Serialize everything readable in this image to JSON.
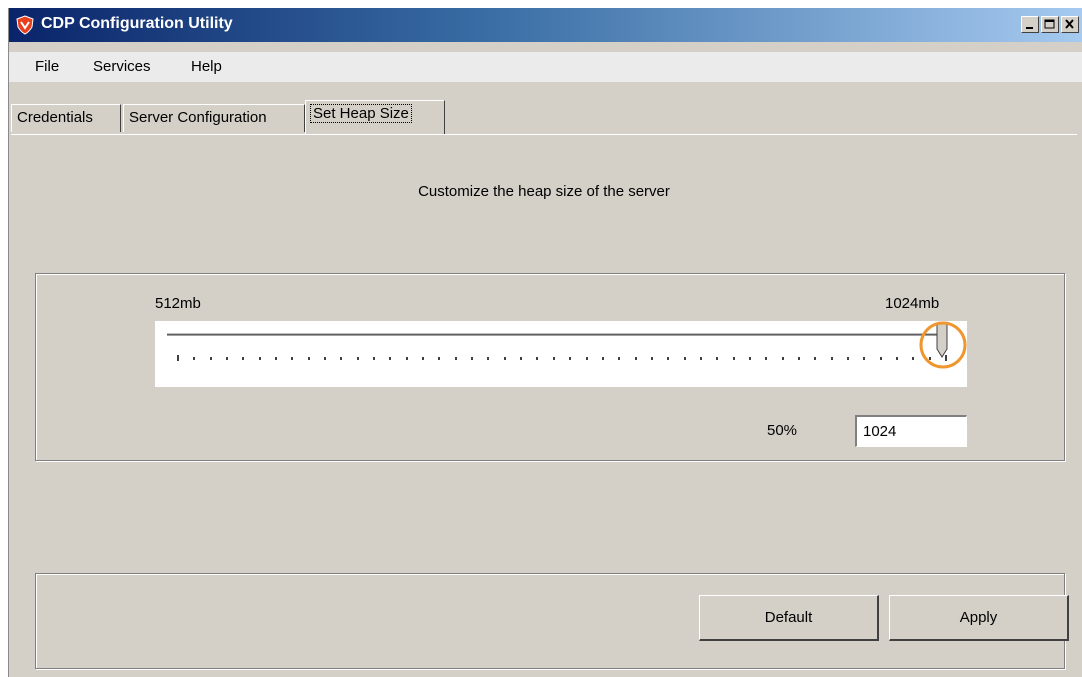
{
  "window": {
    "title": "CDP Configuration Utility"
  },
  "menu": [
    "File",
    "Services",
    "Help"
  ],
  "tabs": [
    {
      "label": "Credentials",
      "active": false
    },
    {
      "label": "Server Configuration",
      "active": false
    },
    {
      "label": "Set Heap Size",
      "active": true
    }
  ],
  "panel": {
    "heading": "Customize the heap size of the server",
    "slider": {
      "min_label": "512mb",
      "max_label": "1024mb",
      "position_fraction": 1.0,
      "tick_count": 48,
      "highlight_color": "#f0962f"
    },
    "percent_label": "50%",
    "heap_value": "1024"
  },
  "buttons": {
    "default_label": "Default",
    "apply_label": "Apply"
  },
  "icons": {
    "app": "shield-logo-icon",
    "minimize": "minimize-icon",
    "maximize": "maximize-icon",
    "close": "close-icon"
  }
}
